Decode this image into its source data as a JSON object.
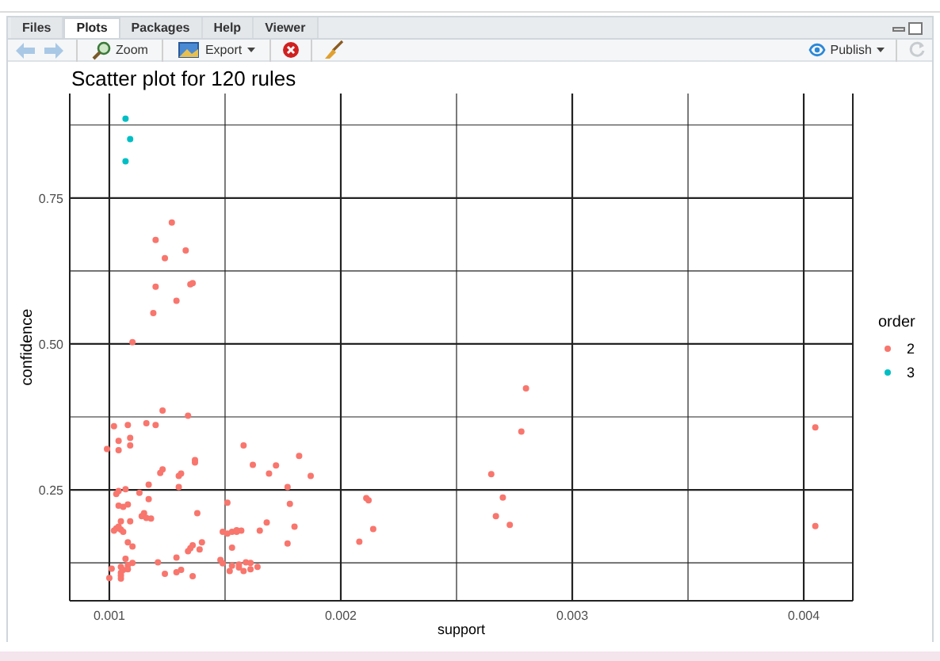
{
  "tabs": [
    {
      "label": "Files",
      "selected": false
    },
    {
      "label": "Plots",
      "selected": true
    },
    {
      "label": "Packages",
      "selected": false
    },
    {
      "label": "Help",
      "selected": false
    },
    {
      "label": "Viewer",
      "selected": false
    }
  ],
  "toolbar": [
    {
      "kind": "back"
    },
    {
      "kind": "forward"
    },
    {
      "kind": "zoom",
      "label": "Zoom"
    },
    {
      "kind": "export",
      "label": "Export"
    },
    {
      "kind": "remove"
    },
    {
      "kind": "clear"
    }
  ],
  "publish": {
    "label": "Publish"
  },
  "plot": {
    "legend_title": "order",
    "chart_data": {
      "type": "scatter",
      "grid": true,
      "legend": "right",
      "title": "Scatter plot for 120 rules",
      "xlabel": "support",
      "ylabel": "confidence",
      "xlim": [
        0.000829,
        0.004212
      ],
      "ylim": [
        0.06,
        0.929
      ],
      "xticks": [
        {
          "value": 0.001,
          "label": "0.001"
        },
        {
          "value": 0.002,
          "label": "0.002"
        },
        {
          "value": 0.003,
          "label": "0.003"
        },
        {
          "value": 0.004,
          "label": "0.004"
        }
      ],
      "yticks": [
        {
          "value": 0.25,
          "label": "0.25"
        },
        {
          "value": 0.5,
          "label": "0.50"
        },
        {
          "value": 0.75,
          "label": "0.75"
        }
      ],
      "series": [
        {
          "name": "2",
          "color": "#f8766d",
          "x": [
            0.00127,
            0.0012,
            0.00124,
            0.00133,
            0.0012,
            0.00135,
            0.00136,
            0.00129,
            0.00119,
            0.0011,
            0.00123,
            0.00134,
            0.00102,
            0.00108,
            0.00116,
            0.0012,
            0.00099,
            0.00104,
            0.00104,
            0.00109,
            0.00109,
            0.00158,
            0.00162,
            0.00123,
            0.00122,
            0.0013,
            0.00131,
            0.00137,
            0.00137,
            0.0013,
            0.00117,
            0.00107,
            0.00104,
            0.00103,
            0.00113,
            0.00117,
            0.00104,
            0.00106,
            0.00108,
            0.00115,
            0.00114,
            0.00116,
            0.00118,
            0.00138,
            0.00151,
            0.00105,
            0.00109,
            0.00102,
            0.00103,
            0.00104,
            0.00105,
            0.00106,
            0.00108,
            0.0011,
            0.00149,
            0.00151,
            0.00153,
            0.00155,
            0.00157,
            0.0014,
            0.00136,
            0.00135,
            0.00139,
            0.00134,
            0.00153,
            0.00107,
            0.0011,
            0.00108,
            0.00121,
            0.00129,
            0.00148,
            0.00149,
            0.00153,
            0.00156,
            0.00159,
            0.00161,
            0.00164,
            0.00101,
            0.00105,
            0.00106,
            0.00108,
            0.00105,
            0.00131,
            0.00129,
            0.00124,
            0.00136,
            0.001,
            0.00105,
            0.00105,
            0.00152,
            0.00158,
            0.0028,
            0.00278,
            0.00265,
            0.0027,
            0.00267,
            0.00273,
            0.00211,
            0.00212,
            0.00214,
            0.00208,
            0.00172,
            0.00169,
            0.00182,
            0.00187,
            0.00177,
            0.00178,
            0.00168,
            0.00165,
            0.0018,
            0.00177,
            0.00155,
            0.00156,
            0.00161,
            0.00405,
            0.00405
          ],
          "values": [
            0.708,
            0.678,
            0.647,
            0.66,
            0.598,
            0.602,
            0.604,
            0.574,
            0.553,
            0.503,
            0.386,
            0.377,
            0.359,
            0.361,
            0.364,
            0.361,
            0.32,
            0.318,
            0.334,
            0.326,
            0.339,
            0.326,
            0.293,
            0.285,
            0.279,
            0.274,
            0.278,
            0.297,
            0.301,
            0.255,
            0.259,
            0.251,
            0.248,
            0.243,
            0.245,
            0.234,
            0.223,
            0.221,
            0.225,
            0.21,
            0.205,
            0.202,
            0.201,
            0.21,
            0.228,
            0.196,
            0.196,
            0.18,
            0.184,
            0.187,
            0.182,
            0.178,
            0.16,
            0.153,
            0.178,
            0.175,
            0.178,
            0.181,
            0.18,
            0.16,
            0.155,
            0.15,
            0.148,
            0.145,
            0.151,
            0.132,
            0.125,
            0.121,
            0.126,
            0.134,
            0.13,
            0.124,
            0.12,
            0.117,
            0.126,
            0.114,
            0.118,
            0.115,
            0.118,
            0.113,
            0.114,
            0.108,
            0.113,
            0.109,
            0.106,
            0.102,
            0.099,
            0.098,
            0.103,
            0.111,
            0.111,
            0.424,
            0.35,
            0.277,
            0.237,
            0.205,
            0.19,
            0.236,
            0.232,
            0.183,
            0.161,
            0.292,
            0.278,
            0.308,
            0.274,
            0.255,
            0.226,
            0.194,
            0.18,
            0.187,
            0.158,
            0.178,
            0.122,
            0.125,
            0.357,
            0.188
          ]
        },
        {
          "name": "3",
          "color": "#00bfc4",
          "x": [
            0.00107,
            0.00109,
            0.00107
          ],
          "values": [
            0.886,
            0.851,
            0.813
          ]
        }
      ]
    }
  }
}
